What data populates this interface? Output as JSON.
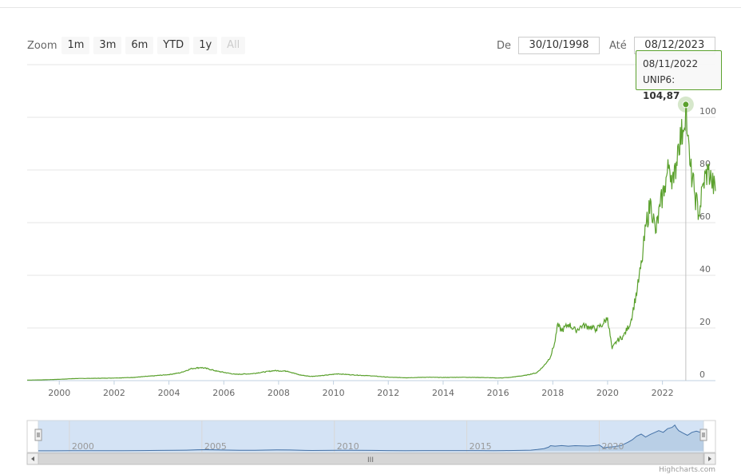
{
  "zoom": {
    "label": "Zoom",
    "buttons": [
      {
        "label": "1m",
        "enabled": true
      },
      {
        "label": "3m",
        "enabled": true
      },
      {
        "label": "6m",
        "enabled": true
      },
      {
        "label": "YTD",
        "enabled": true
      },
      {
        "label": "1y",
        "enabled": true
      },
      {
        "label": "All",
        "enabled": false
      }
    ]
  },
  "range": {
    "from_label": "De",
    "from_value": "30/10/1998",
    "to_label": "Até",
    "to_value": "08/12/2023"
  },
  "tooltip": {
    "date": "08/11/2022",
    "series": "UNIP6",
    "sep": ": ",
    "value": "104,87"
  },
  "credits": "Highcharts.com",
  "colors": {
    "series": "#5ba12e",
    "navigator_line": "#4572a7",
    "navigator_fill": "#e6eef8",
    "navigator_mask": "#d4e3f5"
  },
  "navigator": {
    "labels": [
      "2000",
      "2005",
      "2010",
      "2015",
      "2020"
    ],
    "scroll_grip": "III"
  },
  "chart_data": {
    "type": "line",
    "series": [
      {
        "name": "UNIP6",
        "points": [
          [
            "1998-10-30",
            0.2
          ],
          [
            "1999-06-01",
            0.3
          ],
          [
            "2000-01-01",
            0.5
          ],
          [
            "2000-08-01",
            0.8
          ],
          [
            "2001-06-01",
            0.9
          ],
          [
            "2002-01-01",
            1.0
          ],
          [
            "2002-09-01",
            1.2
          ],
          [
            "2003-06-01",
            1.8
          ],
          [
            "2004-01-01",
            2.3
          ],
          [
            "2004-06-01",
            3.0
          ],
          [
            "2004-11-01",
            4.6
          ],
          [
            "2005-03-01",
            5.0
          ],
          [
            "2005-06-01",
            4.5
          ],
          [
            "2005-10-01",
            3.6
          ],
          [
            "2006-06-01",
            2.4
          ],
          [
            "2007-01-01",
            2.6
          ],
          [
            "2007-06-01",
            3.2
          ],
          [
            "2007-11-01",
            3.8
          ],
          [
            "2008-05-01",
            3.6
          ],
          [
            "2008-10-01",
            2.2
          ],
          [
            "2009-03-01",
            1.6
          ],
          [
            "2009-09-01",
            2.0
          ],
          [
            "2010-03-01",
            2.6
          ],
          [
            "2010-09-01",
            2.2
          ],
          [
            "2011-06-01",
            1.8
          ],
          [
            "2012-01-01",
            1.3
          ],
          [
            "2012-09-01",
            1.1
          ],
          [
            "2013-06-01",
            1.3
          ],
          [
            "2014-01-01",
            1.2
          ],
          [
            "2014-09-01",
            1.3
          ],
          [
            "2015-06-01",
            1.2
          ],
          [
            "2016-01-01",
            1.0
          ],
          [
            "2016-06-01",
            1.2
          ],
          [
            "2017-01-01",
            2.0
          ],
          [
            "2017-06-01",
            3.0
          ],
          [
            "2017-09-01",
            5.5
          ],
          [
            "2017-12-01",
            9.0
          ],
          [
            "2018-02-01",
            15.0
          ],
          [
            "2018-03-01",
            21.0
          ],
          [
            "2018-05-01",
            19.0
          ],
          [
            "2018-08-01",
            21.5
          ],
          [
            "2018-11-01",
            19.0
          ],
          [
            "2019-02-01",
            21.0
          ],
          [
            "2019-05-01",
            20.5
          ],
          [
            "2019-08-01",
            19.5
          ],
          [
            "2019-11-01",
            21.5
          ],
          [
            "2020-01-01",
            24.0
          ],
          [
            "2020-03-01",
            12.0
          ],
          [
            "2020-05-01",
            15.0
          ],
          [
            "2020-08-01",
            17.0
          ],
          [
            "2020-11-01",
            22.0
          ],
          [
            "2021-02-01",
            35.0
          ],
          [
            "2021-04-01",
            45.0
          ],
          [
            "2021-06-01",
            60.0
          ],
          [
            "2021-08-01",
            68.0
          ],
          [
            "2021-10-01",
            56.0
          ],
          [
            "2021-12-01",
            66.0
          ],
          [
            "2022-02-01",
            74.0
          ],
          [
            "2022-04-01",
            82.0
          ],
          [
            "2022-06-01",
            75.0
          ],
          [
            "2022-08-01",
            90.0
          ],
          [
            "2022-10-01",
            95.0
          ],
          [
            "2022-11-08",
            104.87
          ],
          [
            "2022-12-01",
            93.0
          ],
          [
            "2023-01-01",
            82.0
          ],
          [
            "2023-03-01",
            72.0
          ],
          [
            "2023-05-01",
            63.0
          ],
          [
            "2023-07-01",
            75.0
          ],
          [
            "2023-09-01",
            80.0
          ],
          [
            "2023-10-15",
            76.0
          ],
          [
            "2023-12-08",
            72.0
          ]
        ]
      }
    ],
    "x_ticks": [
      "2000",
      "2002",
      "2004",
      "2006",
      "2008",
      "2010",
      "2012",
      "2014",
      "2016",
      "2018",
      "2020",
      "2022"
    ],
    "y_ticks": [
      "0",
      "20",
      "40",
      "60",
      "80",
      "100"
    ],
    "xlim": [
      "1998-10-30",
      "2023-12-08"
    ],
    "ylim": [
      0,
      120
    ],
    "highlight": {
      "x": "2022-11-08",
      "y": 104.87
    },
    "grid": true,
    "legend": "none"
  }
}
